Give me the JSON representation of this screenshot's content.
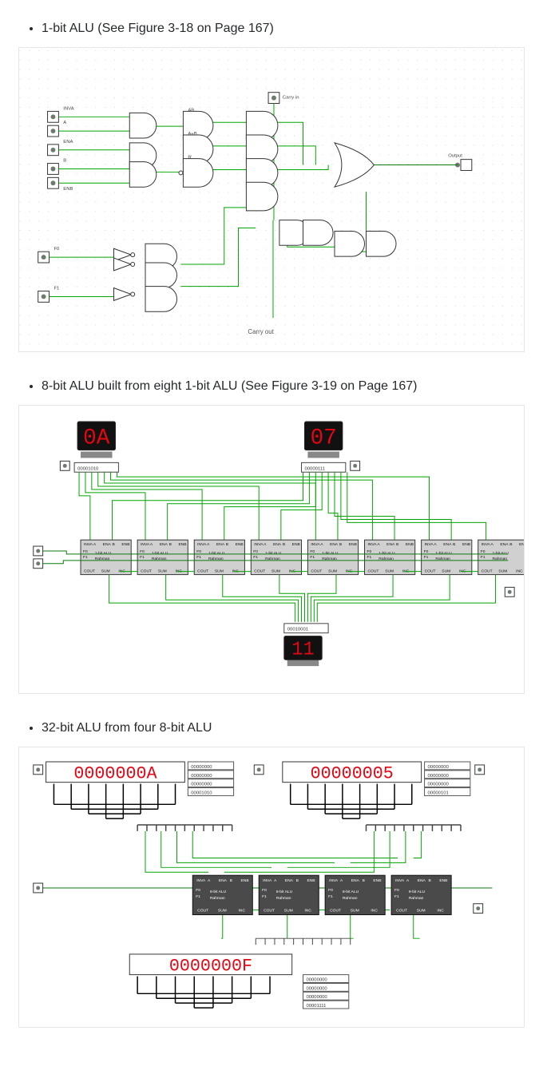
{
  "sections": [
    {
      "title": "1-bit ALU (See Figure 3-18 on Page 167)"
    },
    {
      "title": "8-bit ALU built from eight 1-bit ALU (See Figure 3-19 on Page 167)"
    },
    {
      "title": "32-bit ALU from four 8-bit ALU"
    }
  ],
  "fig1": {
    "inputs": [
      "INVA",
      "A",
      "ENA",
      "B",
      "ENB",
      "F0",
      "F1"
    ],
    "top_input": "Carry in",
    "output": "Output",
    "bottom_output": "Carry out",
    "mid_labels": [
      "AB",
      "A+B",
      "B'"
    ]
  },
  "fig2": {
    "displayA": "0A",
    "displayB": "07",
    "binA": "00001010",
    "binB": "00000111",
    "result_bin": "00010001",
    "displayR": "11",
    "block_top_pins": [
      "INVA",
      "A",
      "ENA",
      "B",
      "ENB"
    ],
    "block_name": "1-bit ALU",
    "block_author": "Rahman",
    "block_left_pins": [
      "F0",
      "F1"
    ],
    "block_bottom_pins": [
      "COUT",
      "SUM",
      "INC"
    ]
  },
  "fig3": {
    "displayA": "0000000A",
    "displayB": "00000005",
    "displayR": "0000000F",
    "binA_rows": [
      "00000000",
      "00000000",
      "00000000",
      "00001010"
    ],
    "binB_rows": [
      "00000000",
      "00000000",
      "00000000",
      "00000101"
    ],
    "binR_rows": [
      "00000000",
      "00000000",
      "00000000",
      "00001111"
    ],
    "block_top_pins": [
      "INVA",
      "A",
      "ENA",
      "B",
      "ENB"
    ],
    "block_name": "8-bit ALU",
    "block_author": "Rahman",
    "block_left_pins": [
      "F0",
      "F1"
    ],
    "block_bottom_pins": [
      "COUT",
      "SUM",
      "INC"
    ]
  }
}
